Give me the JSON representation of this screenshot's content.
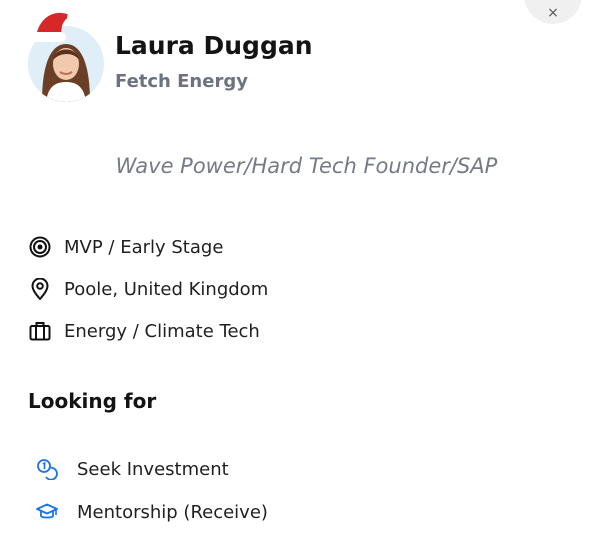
{
  "profile": {
    "name": "Laura Duggan",
    "company": "Fetch Energy",
    "tagline": "Wave Power/Hard Tech Founder/SAP"
  },
  "details": [
    {
      "icon": "target-icon",
      "label": "MVP / Early Stage"
    },
    {
      "icon": "location-pin-icon",
      "label": "Poole, United Kingdom"
    },
    {
      "icon": "briefcase-icon",
      "label": "Energy / Climate Tech"
    }
  ],
  "looking_for": {
    "title": "Looking for",
    "items": [
      {
        "icon": "coins-icon",
        "label": "Seek Investment"
      },
      {
        "icon": "graduation-cap-icon",
        "label": "Mentorship (Receive)"
      }
    ]
  },
  "close": {
    "icon": "close-icon",
    "label": "×"
  },
  "colors": {
    "accent": "#1a73e8",
    "muted": "#6b7280",
    "santa_red": "#d62828"
  }
}
